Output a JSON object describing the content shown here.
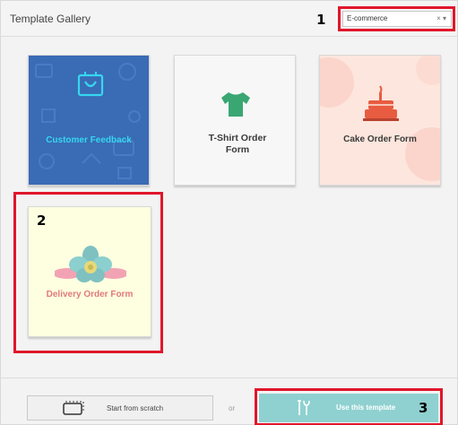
{
  "header": {
    "title": "Template Gallery"
  },
  "category_select": {
    "value": "E-commerce",
    "clear_glyph": "×",
    "arrow_glyph": "▾"
  },
  "annotations": {
    "a1": "1",
    "a2": "2",
    "a3": "3"
  },
  "templates": [
    {
      "label": "Customer Feedback",
      "icon": "shopping-bag-icon"
    },
    {
      "label": "T-Shirt Order Form",
      "icon": "tshirt-icon"
    },
    {
      "label": "Cake Order Form",
      "icon": "cake-icon"
    },
    {
      "label": "Delivery Order Form",
      "icon": "flower-icon"
    }
  ],
  "footer": {
    "scratch_label": "Start from scratch",
    "or_label": "or",
    "use_label": "Use this template"
  },
  "colors": {
    "accent": "#8fd1d0",
    "highlight": "#e0162b",
    "blue_card": "#3a6bb5"
  }
}
